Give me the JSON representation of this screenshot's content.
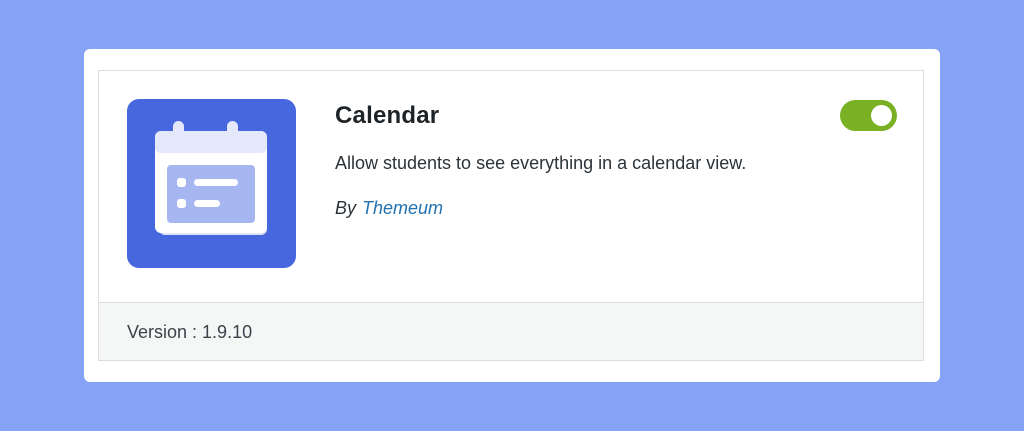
{
  "addon": {
    "title": "Calendar",
    "description": "Allow students to see everything in a calendar view.",
    "author_prefix": "By",
    "author_name": "Themeum",
    "version_text": "Version : 1.9.10",
    "enabled": true,
    "icon": "calendar-icon"
  },
  "colors": {
    "page_background": "#86a2f7",
    "icon_background": "#4767de",
    "toggle_on": "#7ab024",
    "author_link": "#2271b1"
  }
}
